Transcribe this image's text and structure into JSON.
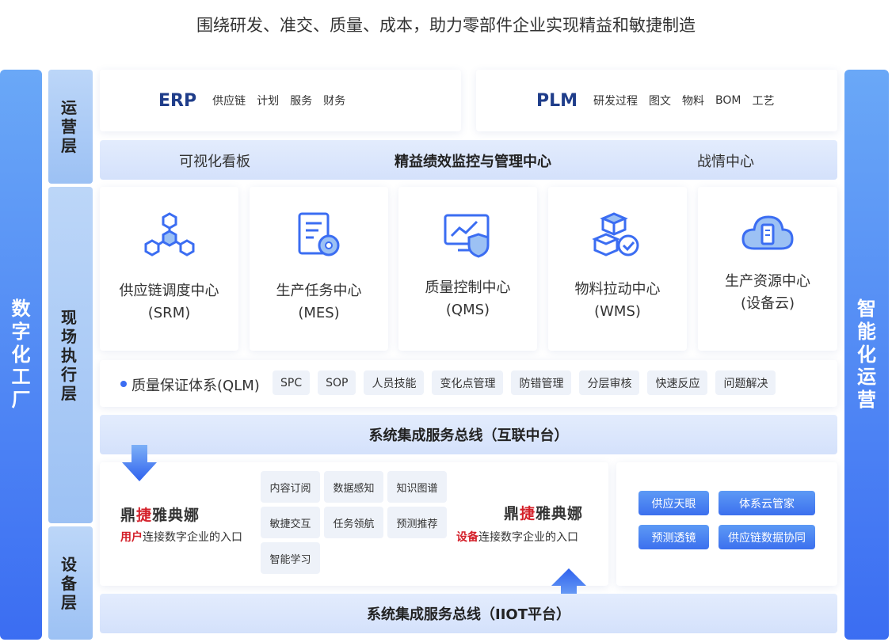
{
  "headline": "围绕研发、准交、质量、成本，助力零部件企业实现精益和敏捷制造",
  "left_bar": "数字化工厂",
  "right_bar": "智能化运营",
  "layers": {
    "operations": "运营层",
    "execution": "现场执行层",
    "equipment": "设备层"
  },
  "erp": {
    "title": "ERP",
    "items": [
      "供应链",
      "计划",
      "服务",
      "财务"
    ]
  },
  "plm": {
    "title": "PLM",
    "items": [
      "研发过程",
      "图文",
      "物料",
      "BOM",
      "工艺"
    ]
  },
  "monitor_band": {
    "left": "可视化看板",
    "center": "精益绩效监控与管理中心",
    "right": "战情中心"
  },
  "centers": [
    {
      "line1": "供应链调度中心",
      "line2": "(SRM)",
      "icon": "supply-chain-network-icon"
    },
    {
      "line1": "生产任务中心",
      "line2": "(MES)",
      "icon": "task-document-gear-icon"
    },
    {
      "line1": "质量控制中心",
      "line2": "(QMS)",
      "icon": "quality-chart-shield-icon"
    },
    {
      "line1": "物料拉动中心",
      "line2": "(WMS)",
      "icon": "material-boxes-check-icon"
    },
    {
      "line1": "生产资源中心",
      "line2": "(设备云)",
      "icon": "resource-cloud-icon"
    }
  ],
  "qlm": {
    "label": "质量保证体系(QLM)",
    "items": [
      "SPC",
      "SOP",
      "人员技能",
      "变化点管理",
      "防错管理",
      "分层审核",
      "快速反应",
      "问题解决"
    ]
  },
  "bus_top": "系统集成服务总线（互联中台）",
  "bus_bottom": "系统集成服务总线（IIOT平台）",
  "brand": {
    "part1": "鼎",
    "part2": "捷",
    "part3": "雅典娜"
  },
  "user_entry": {
    "highlight": "用户",
    "rest": "连接数字企业的入口"
  },
  "device_entry": {
    "highlight": "设备",
    "rest": "连接数字企业的入口"
  },
  "features": [
    "内容订阅",
    "数据感知",
    "知识图谱",
    "敏捷交互",
    "任务领航",
    "预测推荐",
    "智能学习"
  ],
  "supply_buttons": [
    "供应天眼",
    "体系云管家",
    "预测透镜",
    "供应链数据协同"
  ],
  "colors": {
    "accent": "#3b6df2",
    "brand_dark": "#1f3d8a",
    "brand_red": "#d4202a",
    "layer_bg": "#a9c9f5",
    "band_bg": "#dbe6fc"
  }
}
